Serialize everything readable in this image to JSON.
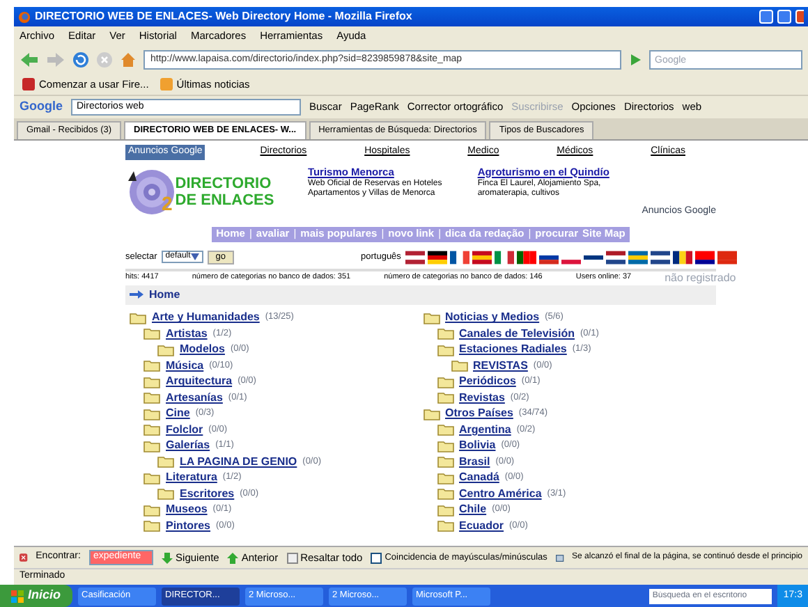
{
  "window": {
    "title": "DIRECTORIO WEB DE ENLACES- Web Directory Home - Mozilla Firefox"
  },
  "menu": [
    "Archivo",
    "Editar",
    "Ver",
    "Historial",
    "Marcadores",
    "Herramientas",
    "Ayuda"
  ],
  "address": {
    "value": "http://www.lapaisa.com/directorio/index.php?sid=8239859878&site_map"
  },
  "search": {
    "placeholder": "Google"
  },
  "bookmarks": [
    "Comenzar a usar Fire...",
    "Últimas noticias"
  ],
  "google_toolbar": {
    "logo": "Google",
    "query": "Directorios web",
    "buttons": [
      {
        "label": "Buscar",
        "disabled": false
      },
      {
        "label": "PageRank",
        "disabled": false
      },
      {
        "label": "Corrector ortográfico",
        "disabled": false
      },
      {
        "label": "Suscribirse",
        "disabled": true
      },
      {
        "label": "Opciones",
        "disabled": false
      },
      {
        "label": "Directorios",
        "disabled": false
      },
      {
        "label": "web",
        "disabled": false
      }
    ]
  },
  "tabs": [
    {
      "label": "Gmail - Recibidos (3)",
      "selected": false
    },
    {
      "label": "DIRECTORIO WEB DE ENLACES- W...",
      "selected": true
    },
    {
      "label": "Herramientas de Búsqueda: Directorios",
      "selected": false
    },
    {
      "label": "Tipos de Buscadores",
      "selected": false
    }
  ],
  "page": {
    "ad_links": [
      {
        "label": "Anuncios Google",
        "selected": true
      },
      {
        "label": "Directorios",
        "selected": false
      },
      {
        "label": "Hospitales",
        "selected": false
      },
      {
        "label": "Medico",
        "selected": false
      },
      {
        "label": "Médicos",
        "selected": false
      },
      {
        "label": "Clínicas",
        "selected": false
      }
    ],
    "logo": {
      "line_1": "DIRECTORIO",
      "line_2": "DE ENLACES",
      "digit": "2"
    },
    "ads": [
      {
        "title": "Turismo Menorca",
        "text": "Web Oficial de Reservas en Hoteles Apartamentos y Villas de Menorca"
      },
      {
        "title": "Agroturismo en el Quindío",
        "text": "Finca El Laurel, Alojamiento Spa, aromaterapia, cultivos"
      }
    ],
    "ads_by": "Anuncios Google",
    "nav": [
      {
        "kind": "link",
        "label": "Home"
      },
      {
        "kind": "separator",
        "label": "|"
      },
      {
        "kind": "link",
        "label": "avaliar"
      },
      {
        "kind": "separator",
        "label": "|"
      },
      {
        "kind": "link",
        "label": "mais populares"
      },
      {
        "kind": "separator",
        "label": "|"
      },
      {
        "kind": "link",
        "label": "novo link"
      },
      {
        "kind": "separator",
        "label": "|"
      },
      {
        "kind": "link",
        "label": "dica da redação"
      },
      {
        "kind": "separator",
        "label": "|"
      },
      {
        "kind": "link",
        "label": "procurar"
      },
      {
        "kind": "link",
        "label": "Site Map"
      }
    ],
    "select_label": "selectar",
    "select_value": "default",
    "go": "go",
    "language": "português",
    "stats": [
      "hits: 4417",
      "número de categorias no banco de dados: 351",
      "número de categorias no banco de dados: 146",
      "Users online: 37"
    ],
    "login_status": "não registrado",
    "breadcrumb": "Home",
    "columns": [
      [
        {
          "label": "Arte y Humanidades",
          "count": "(13/25)",
          "children": [
            {
              "label": "Artistas",
              "count": "(1/2)",
              "children": [
                {
                  "label": "Modelos",
                  "count": "(0/0)"
                }
              ]
            },
            {
              "label": "Música",
              "count": "(0/10)"
            },
            {
              "label": "Arquitectura",
              "count": "(0/0)"
            },
            {
              "label": "Artesanías",
              "count": "(0/1)"
            },
            {
              "label": "Cine",
              "count": "(0/3)"
            },
            {
              "label": "Folclor",
              "count": "(0/0)"
            },
            {
              "label": "Galerías",
              "count": "(1/1)",
              "children": [
                {
                  "label": "LA PAGINA DE GENIO",
                  "count": "(0/0)"
                }
              ]
            },
            {
              "label": "Literatura",
              "count": "(1/2)",
              "children": [
                {
                  "label": "Escritores",
                  "count": "(0/0)"
                }
              ]
            },
            {
              "label": "Museos",
              "count": "(0/1)"
            },
            {
              "label": "Pintores",
              "count": "(0/0)"
            }
          ]
        }
      ],
      [
        {
          "label": "Noticias y Medios",
          "count": "(5/6)",
          "children": [
            {
              "label": "Canales de Televisión",
              "count": "(0/1)"
            },
            {
              "label": "Estaciones Radiales",
              "count": "(1/3)",
              "children": [
                {
                  "label": "REVISTAS",
                  "count": "(0/0)"
                }
              ]
            },
            {
              "label": "Periódicos",
              "count": "(0/1)"
            },
            {
              "label": "Revistas",
              "count": "(0/2)"
            }
          ]
        },
        {
          "label": "Otros Países",
          "count": "(34/74)",
          "children": [
            {
              "label": "Argentina",
              "count": "(0/2)"
            },
            {
              "label": "Bolivia",
              "count": "(0/0)"
            },
            {
              "label": "Brasil",
              "count": "(0/0)"
            },
            {
              "label": "Canadá",
              "count": "(0/0)"
            },
            {
              "label": "Centro América",
              "count": "(3/1)"
            },
            {
              "label": "Chile",
              "count": "(0/0)"
            },
            {
              "label": "Ecuador",
              "count": "(0/0)"
            }
          ]
        }
      ]
    ]
  },
  "find_bar": {
    "label": "Encontrar:",
    "value": "expediente",
    "not_found": true,
    "buttons": [
      "Siguiente",
      "Anterior",
      "Resaltar todo"
    ],
    "match_case": {
      "label": "Coincidencia de mayúsculas/minúsculas",
      "checked": false
    },
    "message": "Se alcanzó el final de la página, se continuó desde el principio"
  },
  "status_bar": "Terminado",
  "taskbar": {
    "start": "Inicio",
    "items": [
      {
        "label": "Casificación",
        "selected": false
      },
      {
        "label": "DIRECTOR...",
        "selected": true
      },
      {
        "label": "2 Microso...",
        "selected": false
      },
      {
        "label": "2 Microso...",
        "selected": false
      },
      {
        "label": "Microsoft P...",
        "selected": false
      }
    ],
    "desk_search": {
      "placeholder": "Búsqueda en el escritorio"
    },
    "clock": "17:3"
  }
}
